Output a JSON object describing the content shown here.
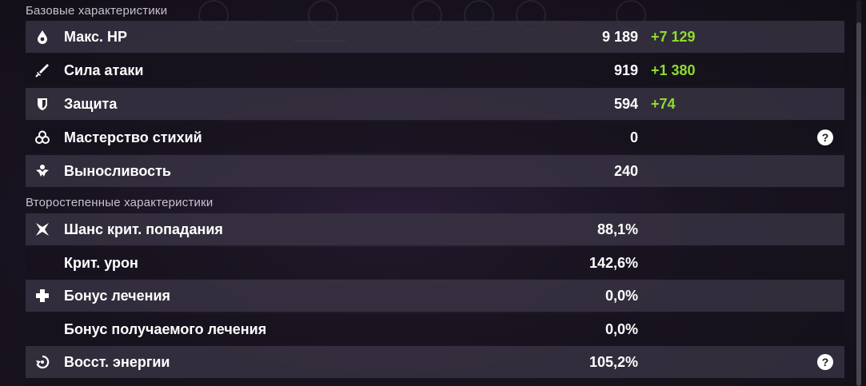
{
  "sections": {
    "base_title": "Базовые характеристики",
    "secondary_title": "Второстепенные характеристики"
  },
  "base_stats": [
    {
      "label": "Макс. HP",
      "value": "9 189",
      "bonus": "+7 129",
      "icon": "hp-drop-icon",
      "help": ""
    },
    {
      "label": "Сила атаки",
      "value": "919",
      "bonus": "+1 380",
      "icon": "sword-icon",
      "help": ""
    },
    {
      "label": "Защита",
      "value": "594",
      "bonus": "+74",
      "icon": "shield-icon",
      "help": ""
    },
    {
      "label": "Мастерство стихий",
      "value": "0",
      "bonus": "",
      "icon": "elemental-mastery-icon",
      "help": "?"
    },
    {
      "label": "Выносливость",
      "value": "240",
      "bonus": "",
      "icon": "stamina-icon",
      "help": ""
    }
  ],
  "secondary_stats": [
    {
      "label": "Шанс крит. попадания",
      "value": "88,1%",
      "icon": "crit-rate-icon",
      "help": ""
    },
    {
      "label": "Крит. урон",
      "value": "142,6%",
      "icon": "",
      "help": ""
    },
    {
      "label": "Бонус лечения",
      "value": "0,0%",
      "icon": "healing-cross-icon",
      "help": ""
    },
    {
      "label": "Бонус получаемого лечения",
      "value": "0,0%",
      "icon": "",
      "help": ""
    },
    {
      "label": "Восст. энергии",
      "value": "105,2%",
      "icon": "energy-recharge-icon",
      "help": "?"
    }
  ],
  "colors": {
    "bonus": "#8edc2f",
    "row_light": "#3a3444",
    "row_dark": "#16121c"
  }
}
